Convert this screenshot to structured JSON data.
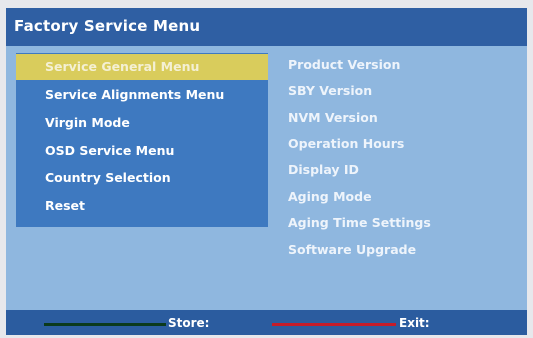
{
  "header": {
    "title": "Factory Service Menu"
  },
  "left_menu": {
    "items": [
      {
        "label": "Service General Menu",
        "selected": true
      },
      {
        "label": "Service Alignments Menu",
        "selected": false
      },
      {
        "label": "Virgin Mode",
        "selected": false
      },
      {
        "label": "OSD Service Menu",
        "selected": false
      },
      {
        "label": "Country Selection",
        "selected": false
      },
      {
        "label": "Reset",
        "selected": false
      }
    ]
  },
  "right_menu": {
    "items": [
      {
        "label": "Product Version"
      },
      {
        "label": "SBY Version"
      },
      {
        "label": "NVM Version"
      },
      {
        "label": "Operation Hours"
      },
      {
        "label": "Display ID"
      },
      {
        "label": "Aging Mode"
      },
      {
        "label": "Aging Time Settings"
      },
      {
        "label": "Software Upgrade"
      }
    ]
  },
  "footer": {
    "store_label": "Store:",
    "exit_label": "Exit:",
    "store_key_color": "#0b3a1c",
    "exit_key_color": "#c41d2a"
  },
  "colors": {
    "title_bar": "#2f5fa3",
    "content_bg": "#8fb7df",
    "menu_panel": "#3e79c0",
    "selection_highlight": "#d9cc5c",
    "footer_bg": "#2b5c9f"
  }
}
